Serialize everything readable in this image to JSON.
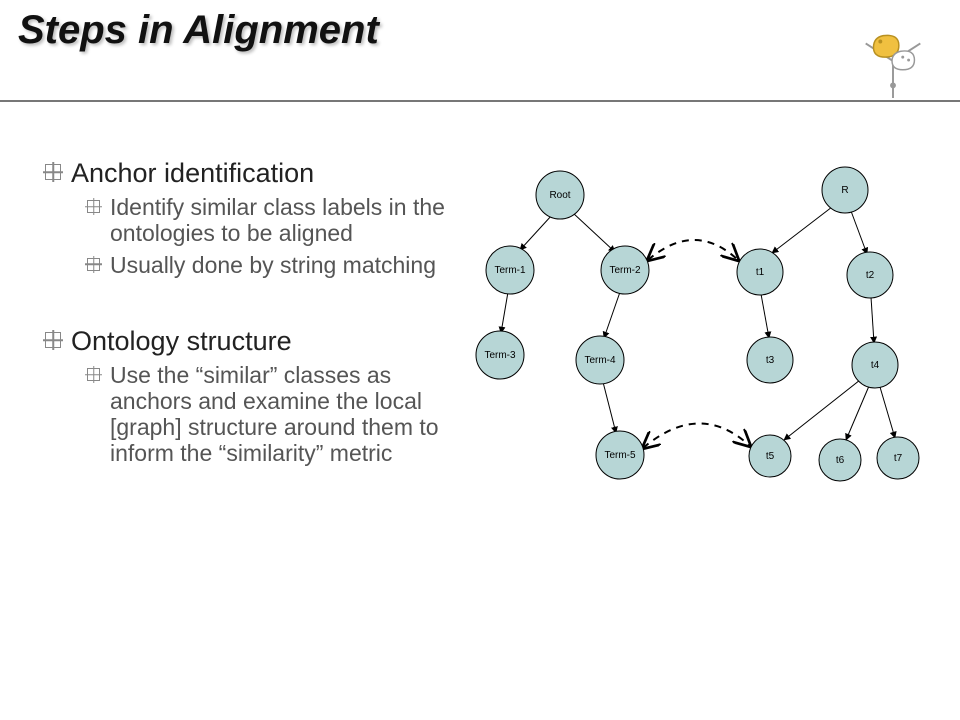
{
  "title": "Steps in Alignment",
  "bullets": {
    "b1": "Anchor identification",
    "b1a": "Identify similar class labels in the ontologies to be aligned",
    "b1b": "Usually done by string matching",
    "b2": "Ontology structure",
    "b2a": "Use the “similar” classes as anchors and examine the local [graph] structure around them to inform the “similarity” metric"
  },
  "graph": {
    "left_tree": {
      "root": "Root",
      "n1": "Term-1",
      "n2": "Term-2",
      "n3": "Term-3",
      "n4": "Term-4",
      "n5": "Term-5"
    },
    "right_tree": {
      "root": "R",
      "n1": "t1",
      "n2": "t2",
      "n3": "t3",
      "n4": "t4",
      "n5": "t5",
      "n6": "t6",
      "n7": "t7"
    },
    "dashed_links": [
      [
        "Term-2",
        "t1"
      ],
      [
        "Term-5",
        "t5"
      ]
    ]
  }
}
